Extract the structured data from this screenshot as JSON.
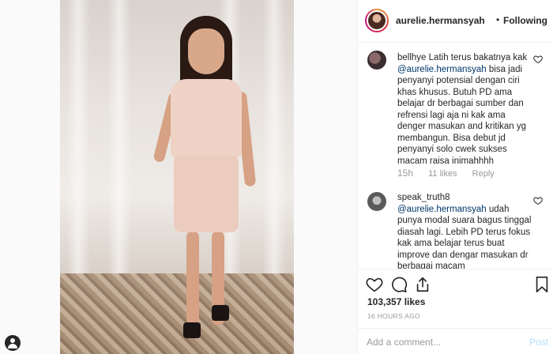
{
  "header": {
    "username": "aurelie.hermansyah",
    "separator": "•",
    "follow_status": "Following"
  },
  "comments": [
    {
      "username": "bellhye",
      "text_before": " Latih terus bakatnya kak ",
      "mention": "@aurelie.hermansyah",
      "text_after": " bisa jadi penyanyi potensial dengan ciri khas khusus. Butuh PD ama belajar dr berbagai sumber dan refrensi lagi aja ni kak ama denger masukan and kritikan yg membangun. Bisa debut jd penyanyi solo cwek sukses macam raisa inimahhhh",
      "age": "15h",
      "likes": "11 likes",
      "reply": "Reply"
    },
    {
      "username": "speak_truth8",
      "text_before": " ",
      "mention": "@aurelie.hermansyah",
      "text_after": " udah punya modal suara bagus tinggal diasah lagi. Lebih PD terus fokus kak ama belajar terus buat improve dan dengar masukan dr berbagai macam"
    }
  ],
  "post": {
    "likes": "103,357 likes",
    "posted": "16 HOURS AGO"
  },
  "add_comment": {
    "placeholder": "Add a comment...",
    "post_label": "Post"
  },
  "icons": [
    "heart-icon",
    "comment-icon",
    "share-icon",
    "bookmark-icon",
    "user-icon"
  ],
  "colors": {
    "link": "#003569",
    "muted": "#999999",
    "post_disabled": "#b2dffc"
  }
}
